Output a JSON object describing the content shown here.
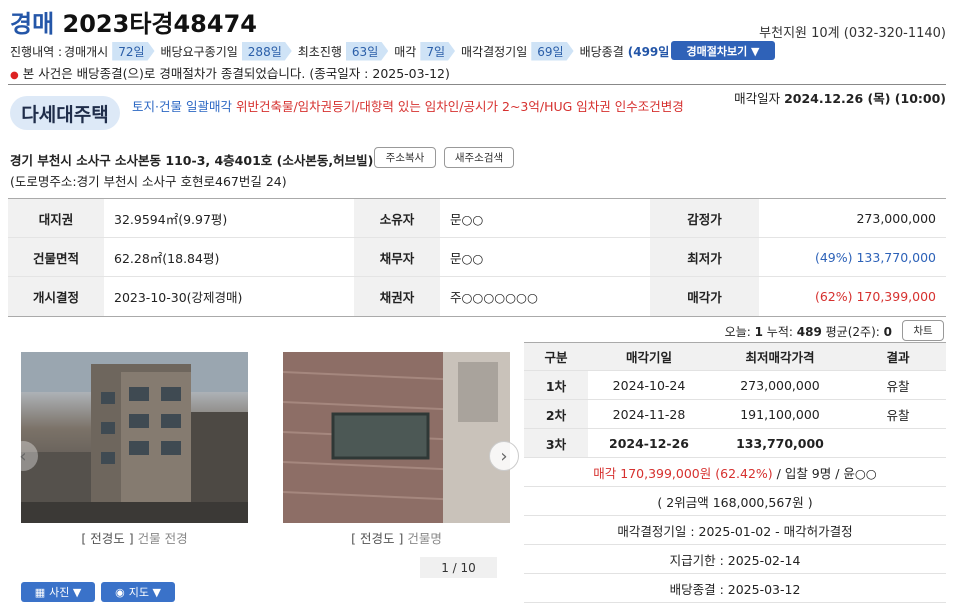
{
  "header": {
    "kind": "경매",
    "case_no": "2023타경48474",
    "court": "부천지원 10계 (032-320-1140)"
  },
  "progress": {
    "label": "진행내역 :",
    "steps": [
      {
        "name": "경매개시",
        "days": "72일"
      },
      {
        "name": "배당요구종기일",
        "days": "288일"
      },
      {
        "name": "최초진행",
        "days": "63일"
      },
      {
        "name": "매각",
        "days": "7일"
      },
      {
        "name": "매각결정기일",
        "days": "69일"
      }
    ],
    "end_label": "배당종결",
    "total": "(499일 소요)",
    "button": "경매절차보기 ▼"
  },
  "notice": "본 사건은 배당종결(으)로 경매절차가 종결되었습니다. (종국일자 : 2025-03-12)",
  "property": {
    "type": "다세대주택",
    "tags_blue": "토지·건물 일괄매각",
    "tags_red": "위반건축물/임차권등기/대항력 있는 임차인/공시가 2~3억/HUG 임차권 인수조건변경",
    "sale_date_label": "매각일자",
    "sale_date": "2024.12.26 (목) (10:00)",
    "address": "경기 부천시 소사구 소사본동 110-3, 4층401호 (소사본동,허브빌)",
    "copy_button": "주소복사",
    "newaddr_button": "새주소검색",
    "road_address": "(도로명주소:경기 부천시 소사구 호현로467번길 24)"
  },
  "info": {
    "rows": [
      {
        "k1": "대지권",
        "v1": "32.9594㎡(9.97평)",
        "k2": "소유자",
        "v2": "문○○",
        "k3": "감정가",
        "v3": "273,000,000",
        "pct": ""
      },
      {
        "k1": "건물면적",
        "v1": "62.28㎡(18.84평)",
        "k2": "채무자",
        "v2": "문○○",
        "k3": "최저가",
        "v3": "133,770,000",
        "pct": "(49%) "
      },
      {
        "k1": "개시결정",
        "v1": "2023-10-30(강제경매)",
        "k2": "채권자",
        "v2": "주○○○○○○○",
        "k3": "매각가",
        "v3": "170,399,000",
        "pct": "(62%) "
      }
    ]
  },
  "stats": {
    "today_label": "오늘:",
    "today": "1",
    "total_label": "누적:",
    "total": "489",
    "avg_label": "평균(2주):",
    "avg": "0",
    "chart_button": "차트"
  },
  "photos": {
    "items": [
      {
        "tag": "[ 전경도 ]",
        "desc": "건물 전경"
      },
      {
        "tag": "[ 전경도 ]",
        "desc": "건물명"
      }
    ],
    "pager": "1 / 10",
    "photo_button": "사진 ▼",
    "map_button": "지도 ▼"
  },
  "history": {
    "headers": [
      "구분",
      "매각기일",
      "최저매각가격",
      "결과"
    ],
    "rows": [
      {
        "round": "1차",
        "date": "2024-10-24",
        "price": "273,000,000",
        "result": "유찰",
        "current": false
      },
      {
        "round": "2차",
        "date": "2024-11-28",
        "price": "191,100,000",
        "result": "유찰",
        "current": false
      },
      {
        "round": "3차",
        "date": "2024-12-26",
        "price": "133,770,000",
        "result": "",
        "current": true
      }
    ],
    "sale_red": "매각 170,399,000원 (62.42%)",
    "sale_rest": " / 입찰 9명 / 윤○○",
    "second": "( 2위금액 168,000,567원 )",
    "decision": "매각결정기일 : 2025-01-02 - 매각허가결정",
    "deadline": "지급기한 : 2025-02-14",
    "end": "배당종결 : 2025-03-12"
  },
  "colors": {
    "accent": "#2456a8",
    "red": "#d6312f",
    "button": "#2f62b8"
  }
}
